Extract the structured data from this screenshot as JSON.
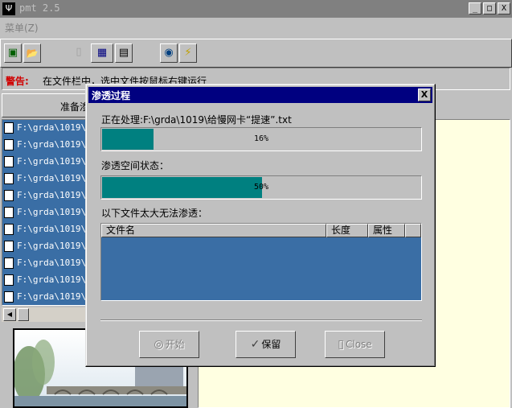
{
  "window": {
    "title": "pmt 2.5",
    "icon_glyph": "Ψ",
    "minimize_glyph": "_",
    "maximize_glyph": "□",
    "close_glyph": "X"
  },
  "menu": {
    "item": "菜单(Z)"
  },
  "toolbar": {
    "tools": [
      {
        "name": "picture-icon",
        "glyph": "▣"
      },
      {
        "name": "folder-open-icon",
        "glyph": "📂"
      },
      {
        "name": "disabled-tool-icon",
        "glyph": "▯"
      },
      {
        "name": "grid-options-icon",
        "glyph": "▦"
      },
      {
        "name": "save-icon",
        "glyph": "▤"
      },
      {
        "name": "globe-user-icon",
        "glyph": "◉"
      },
      {
        "name": "lightning-icon",
        "glyph": "⚡"
      }
    ]
  },
  "warning": {
    "label": "警告:",
    "text": "在文件栏中，选中文件按鼠标右键运行"
  },
  "list": {
    "header": "准备渗",
    "rows": [
      "F:\\grda\\1019\\给",
      "F:\\grda\\1019\\刷",
      "F:\\grda\\1019\\刷",
      "F:\\grda\\1019\\刷",
      "F:\\grda\\1019\\刷",
      "F:\\grda\\1019\\宽",
      "F:\\grda\\1019\\导",
      "F:\\grda\\1019\\如",
      "F:\\grda\\1019\\巧",
      "F:\\grda\\1019\\巧",
      "F:\\grda\\1019\\短"
    ]
  },
  "dialog": {
    "title": "渗透过程",
    "close_glyph": "X",
    "processing_label": "正在处理:F:\\grda\\1019\\给慢网卡“提速”.txt",
    "progress1": {
      "value": 16,
      "text": "16%"
    },
    "space_label": "渗透空间状态：",
    "progress2": {
      "value": 50,
      "text": "50%"
    },
    "too_large_label": "以下文件太大无法渗透：",
    "table_columns": [
      "文件名",
      "长度",
      "属性"
    ],
    "buttons": {
      "start": {
        "label": "开始",
        "icon": "◎"
      },
      "keep": {
        "label": "保留",
        "icon": "✓"
      },
      "close": {
        "label": "Close",
        "icon": "▯"
      }
    }
  },
  "colors": {
    "titlebar_inactive": "#808080",
    "dialog_titlebar": "#000080",
    "selection_blue": "#3a6ea5",
    "progress_teal": "#008080",
    "warning_red": "#d00000",
    "info_pane": "#ffffe1"
  }
}
